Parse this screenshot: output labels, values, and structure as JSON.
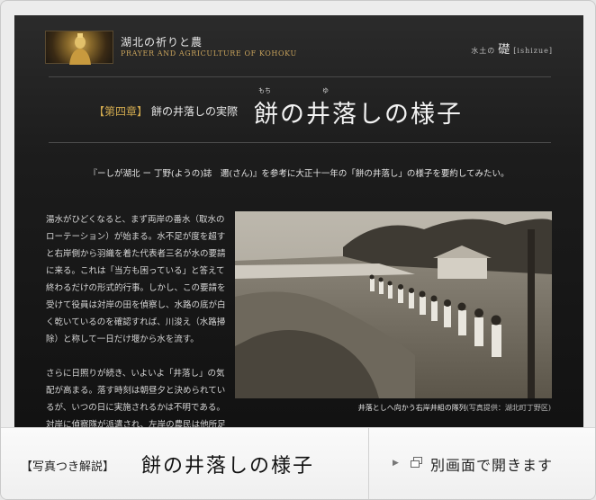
{
  "header": {
    "site_title": "湖北の祈りと農",
    "site_subtitle": "PRAYER AND AGRICULTURE OF KOHOKU",
    "brand_prefix": "水土の",
    "brand_kanji": "礎",
    "brand_suffix": "[ishizue]"
  },
  "chapter": {
    "tag": "【第四章】",
    "label": "餅の井落しの実際"
  },
  "title": {
    "text": "餅の井落しの様子",
    "ruby_mochi": "もち",
    "ruby_i": "ゆ"
  },
  "lead": "『ーしが湖北 ー 丁野(ようの)誌　邇(さん)』を参考に大正十一年の「餅の井落し」の様子を要約してみたい。",
  "body": {
    "p1": "湯水がひどくなると、まず両岸の番水（取水のローテーション）が始まる。水不足が度を超すと右岸側から羽織を着た代表者三名が水の要請に来る。これは「当方も困っている」と答えて終わるだけの形式的行事。しかし、この要請を受けて役員は対岸の田を偵察し、水路の底が白く乾いているのを確認すれば、川浚え（水路掃除）と称して一日だけ堰から水を流す。",
    "p2": "さらに日照りが続き、いよいよ「井落し」の気配が高まる。落す時刻は朝昼夕と決められているが、いつの日に実施されるかは不明である。対岸に偵察隊が派遣され、左岸の農民は他所足止め（"
  },
  "photo": {
    "caption": "井落としへ向かう右岸井組の隊列",
    "credit": "(写真提供：湖北町丁野区)"
  },
  "footer": {
    "tag": "【写真つき解説】",
    "title": "餅の井落しの様子",
    "arrow": "▶",
    "open_label": "別画面で開きます"
  }
}
